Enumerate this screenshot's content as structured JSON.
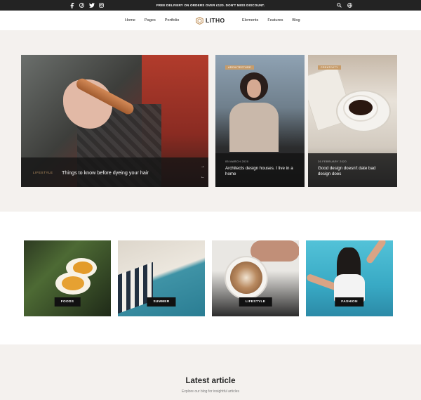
{
  "topbar": {
    "promo": "FREE DELIVERY ON ORDERS OVER £120. DON'T MISS DISCOUNT.",
    "social_icons": [
      "facebook-icon",
      "pinterest-icon",
      "twitter-icon",
      "instagram-icon"
    ],
    "right_icons": [
      "search-icon",
      "globe-icon"
    ]
  },
  "nav": {
    "left": [
      "Home",
      "Pages",
      "Portfolio"
    ],
    "logo": "LITHO",
    "right": [
      "Elements",
      "Features",
      "Blog"
    ]
  },
  "hero": {
    "main": {
      "category": "LIFESTYLE",
      "title": "Things to know before dyeing your hair"
    },
    "cards": [
      {
        "tag": "ARCHITECTURE",
        "date": "05 MARCH 2020",
        "title": "Architects design houses. I live in a home"
      },
      {
        "tag": "CREATIVITY",
        "date": "26 FEBRUARY 2020",
        "title": "Good design doesn't date bad design does"
      }
    ]
  },
  "categories": [
    "FOODS",
    "SUMMER",
    "LIFESTYLE",
    "FASHION"
  ],
  "latest": {
    "heading": "Latest article",
    "subheading": "Explore our blog for insightful articles"
  },
  "colors": {
    "accent": "#c79c6a",
    "dark": "#232323",
    "background": "#f4f1ee"
  }
}
